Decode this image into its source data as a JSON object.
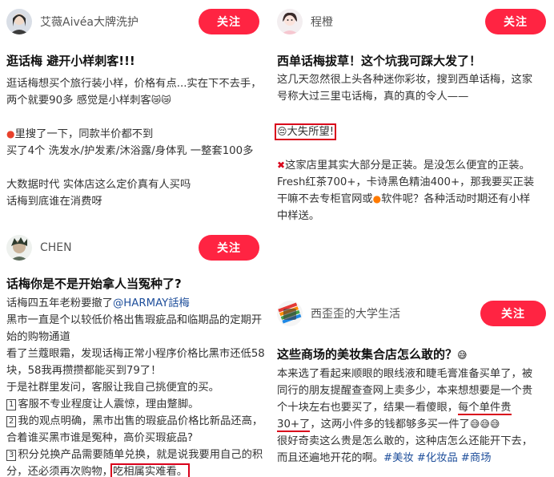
{
  "cards": [
    {
      "user": "艾薇Aivéa大牌洗护",
      "follow_label": "关注",
      "title": "逛话梅 避开小样刺客!!!",
      "lines": [
        "逛话梅想买个旅行装小样，价格有点...实在下不去手，",
        "两个就要90多 感觉是小样刺客",
        "",
        "里搜了一下，同款半价都不到",
        "买了4个 洗发水/护发素/沐浴露/身体乳 一整套100多",
        "",
        "大数据时代 实体店这么定价真有人买吗",
        "话梅到底谁在消费呀"
      ]
    },
    {
      "user": "程橙",
      "follow_label": "关注",
      "title": "西单话梅拔草！这个坑我可踩大发了！",
      "intro": [
        "这几天忽然很上头各种迷你彩妆，搜到西单话梅，这家",
        "号称大过三里屯话梅，真的真的令人——"
      ],
      "highlight": "大失所望!",
      "lines": [
        "这家店里其实大部分是正装。是没怎么便宜的正装。",
        "Fresh红茶700+，卡诗黑色精油400+，那我要买正装",
        "干嘛不去专柜官网或",
        "软件呢？各种活动时期还有小样",
        "中样送。"
      ]
    },
    {
      "user": "CHEN",
      "follow_label": "关注",
      "title": "话梅你是不是开始拿人当冤种了?",
      "mention_prefix": "话梅四五年老粉要撤了",
      "mention": "@HARMAY話梅",
      "lines": [
        "黑市一直是个以较低价格出售瑕疵品和临期品的定期开",
        "始的购物通道",
        "看了兰蔻眼霜，发现话梅正常小程序价格比黑市还低58",
        "块，58我再攒攒都能买到79了！",
        "于是社群里发问，客服让我自己挑便宜的买。"
      ],
      "points": [
        {
          "num": "1",
          "text": "客服不专业程度让人震惊，理由蹩脚。"
        },
        {
          "num": "2",
          "text": "我的观点明确，黑市出售的瑕疵品价格比新品还高，"
        },
        {
          "num": "",
          "text": "合着谁买黑市谁是冤种，高价买瑕疵品?"
        },
        {
          "num": "3",
          "text": "积分兑换产品需要随单兑换，就是说我要用自己的积"
        }
      ],
      "last_prefix": "分，还必须再次购物，",
      "last_boxed": "吃相属实难看。"
    },
    {
      "user": "西歪歪的大学生活",
      "follow_label": "关注",
      "title": "这些商场的美妆集合店怎么敢的？",
      "lines": [
        "本来选了看起来顺眼的眼线液和睫毛膏准备买单了，被",
        "同行的朋友提醒查查网上卖多少，本来想想要是一个贵"
      ],
      "l3_prefix": "个十块左右也要买了，结果一看傻眼，",
      "l3_under": "每个单件贵",
      "l4_under": "30+了",
      "l4_suffix": "，这两小件多的钱都够多买一件了",
      "l5": "很好奇卖这么贵是怎么敢的，这种店怎么还能开下去，",
      "l6_prefix": "而且还遍地开花的啊。",
      "tags": [
        "#美妆",
        "#化妆品",
        "#商场"
      ]
    }
  ],
  "colors": {
    "follow_bg": "#ff2442",
    "mark_red": "#d9001b",
    "link_blue": "#1f4f9b"
  }
}
